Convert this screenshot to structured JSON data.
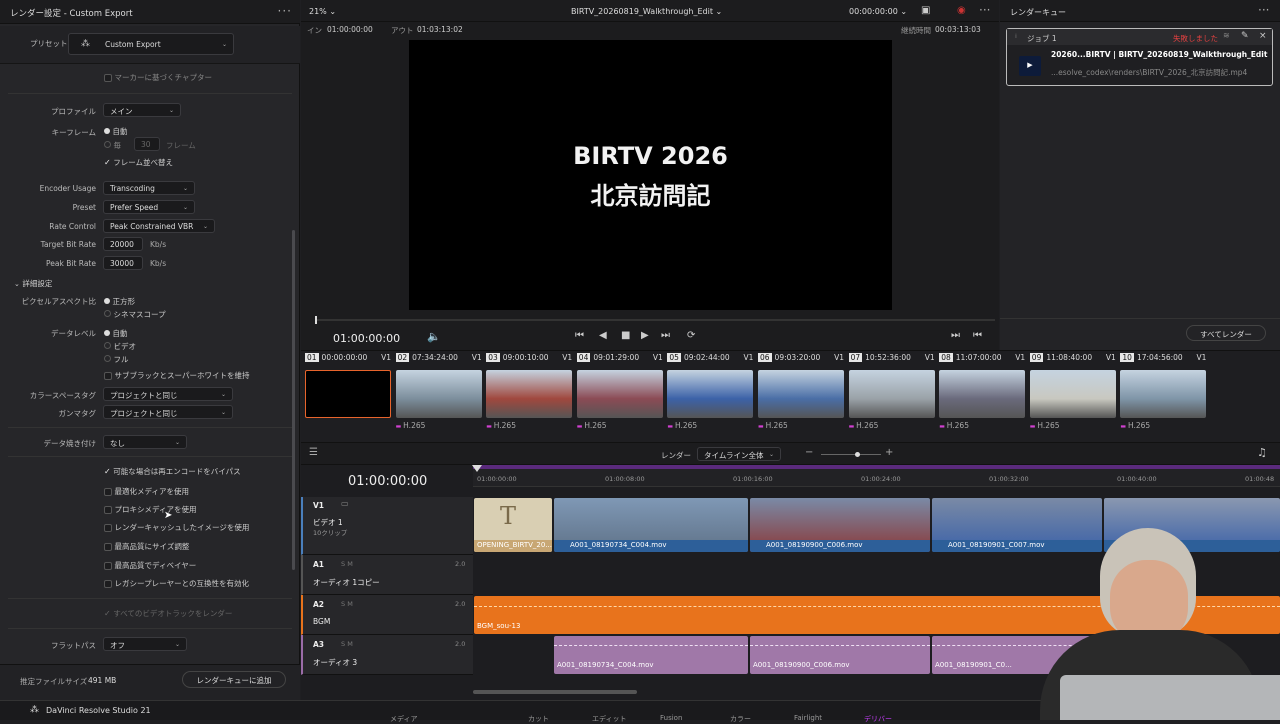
{
  "left_panel": {
    "title": "レンダー設定 - Custom Export",
    "preset_label": "プリセット",
    "preset_value": "Custom Export",
    "marker_chapter": "マーカーに基づくチャプター",
    "profile_label": "プロファイル",
    "profile_value": "メイン",
    "keyframe_label": "キーフレーム",
    "keyframe_auto": "自動",
    "keyframe_every": "毎",
    "keyframe_every_value": "30",
    "keyframe_frames": "フレーム",
    "frame_reorder": "フレーム並べ替え",
    "encoder_usage_label": "Encoder Usage",
    "encoder_usage_value": "Transcoding",
    "preset2_label": "Preset",
    "preset2_value": "Prefer Speed",
    "rate_control_label": "Rate Control",
    "rate_control_value": "Peak Constrained VBR",
    "target_bitrate_label": "Target Bit Rate",
    "target_bitrate_value": "20000",
    "peak_bitrate_label": "Peak Bit Rate",
    "peak_bitrate_value": "30000",
    "kbs": "Kb/s",
    "advanced_label": "詳細設定",
    "pixel_aspect_label": "ピクセルアスペクト比",
    "pixel_square": "正方形",
    "pixel_cinemascope": "シネマスコープ",
    "data_level_label": "データレベル",
    "data_level_auto": "自動",
    "data_level_video": "ビデオ",
    "data_level_full": "フル",
    "subblack": "サブブラックとスーパーホワイトを維持",
    "color_space_label": "カラースペースタグ",
    "color_space_value": "プロジェクトと同じ",
    "gamma_label": "ガンマタグ",
    "gamma_value": "プロジェクトと同じ",
    "data_burn_label": "データ焼き付け",
    "data_burn_value": "なし",
    "bypass": "可能な場合は再エンコードをバイパス",
    "optimized": "最適化メディアを使用",
    "proxy": "プロキシメディアを使用",
    "render_cache": "レンダーキャッシュしたイメージを使用",
    "max_resize": "最高品質にサイズ調整",
    "max_debayer": "最高品質でディベイヤー",
    "legacy": "レガシープレーヤーとの互換性を有効化",
    "all_video_tracks": "すべてのビデオトラックをレンダー",
    "flat_pass_label": "フラットパス",
    "flat_pass_value": "オフ",
    "est_size_label": "推定ファイルサイズ",
    "est_size_value": "491 MB",
    "add_queue": "レンダーキューに追加"
  },
  "viewer": {
    "zoom": "21%",
    "project_title": "BIRTV_20260819_Walkthrough_Edit",
    "timecode_top": "00:00:00:00",
    "in_label": "イン",
    "in_value": "01:00:00:00",
    "out_label": "アウト",
    "out_value": "01:03:13:02",
    "duration_label": "継続時間",
    "duration_value": "00:03:13:03",
    "title_line1": "BIRTV 2026",
    "title_line2": "北京訪問記",
    "current_tc": "01:00:00:00"
  },
  "render_queue": {
    "title": "レンダーキュー",
    "job_label": "ジョブ 1",
    "job_status": "失敗しました",
    "job_name": "20260...BIRTV | BIRTV_20260819_Walkthrough_Edit",
    "job_path": "...esolve_codex\\renders\\BIRTV_2026_北京訪問記.mp4",
    "render_all": "すべてレンダー"
  },
  "clips": [
    {
      "num": "01",
      "tc": "00:00:00:00",
      "track": "V1",
      "codec": "",
      "color": "#000000"
    },
    {
      "num": "02",
      "tc": "07:34:24:00",
      "track": "V1",
      "codec": "H.265",
      "color": "#7c8e9c"
    },
    {
      "num": "03",
      "tc": "09:00:10:00",
      "track": "V1",
      "codec": "H.265",
      "color": "#a0483e"
    },
    {
      "num": "04",
      "tc": "09:01:29:00",
      "track": "V1",
      "codec": "H.265",
      "color": "#8b4b55"
    },
    {
      "num": "05",
      "tc": "09:02:44:00",
      "track": "V1",
      "codec": "H.265",
      "color": "#3c62a8"
    },
    {
      "num": "06",
      "tc": "09:03:20:00",
      "track": "V1",
      "codec": "H.265",
      "color": "#4a6ea6"
    },
    {
      "num": "07",
      "tc": "10:52:36:00",
      "track": "V1",
      "codec": "H.265",
      "color": "#9aa2a8"
    },
    {
      "num": "08",
      "tc": "11:07:00:00",
      "track": "V1",
      "codec": "H.265",
      "color": "#6a6a7c"
    },
    {
      "num": "09",
      "tc": "11:08:40:00",
      "track": "V1",
      "codec": "H.265",
      "color": "#c8c8c0"
    },
    {
      "num": "10",
      "tc": "17:04:56:00",
      "track": "V1",
      "codec": "H.265",
      "color": "#7f95a8"
    }
  ],
  "timeline": {
    "render_label": "レンダー",
    "render_scope": "タイムライン全体",
    "timecode": "01:00:00:00",
    "ruler": [
      "01:00:00:00",
      "01:00:08:00",
      "01:00:16:00",
      "01:00:24:00",
      "01:00:32:00",
      "01:00:40:00",
      "01:00:48"
    ],
    "v1_name": "V1",
    "v1_label": "ビデオ 1",
    "v1_sub": "10クリップ",
    "a1_name": "A1",
    "a1_label": "オーディオ 1コピー",
    "a1_level": "2.0",
    "a2_name": "A2",
    "a2_label": "BGM",
    "a2_level": "2.0",
    "a3_name": "A3",
    "a3_label": "オーディオ 3",
    "a3_level": "2.0",
    "clip_opening": "OPENING_BIRTV_20...",
    "clip_v1": "A001_08190734_C004.mov",
    "clip_v2": "A001_08190900_C006.mov",
    "clip_v3": "A001_08190901_C007.mov",
    "clip_bgm": "BGM_sou-13",
    "clip_a3_1": "A001_08190734_C004.mov",
    "clip_a3_2": "A001_08190900_C006.mov",
    "clip_a3_3": "A001_08190901_C0..."
  },
  "bottom_bar": {
    "app_name": "DaVinci Resolve Studio 21",
    "pages": [
      "メディア",
      "カット",
      "エディット",
      "Fusion",
      "カラー",
      "Fairlight",
      "デリバー"
    ]
  }
}
